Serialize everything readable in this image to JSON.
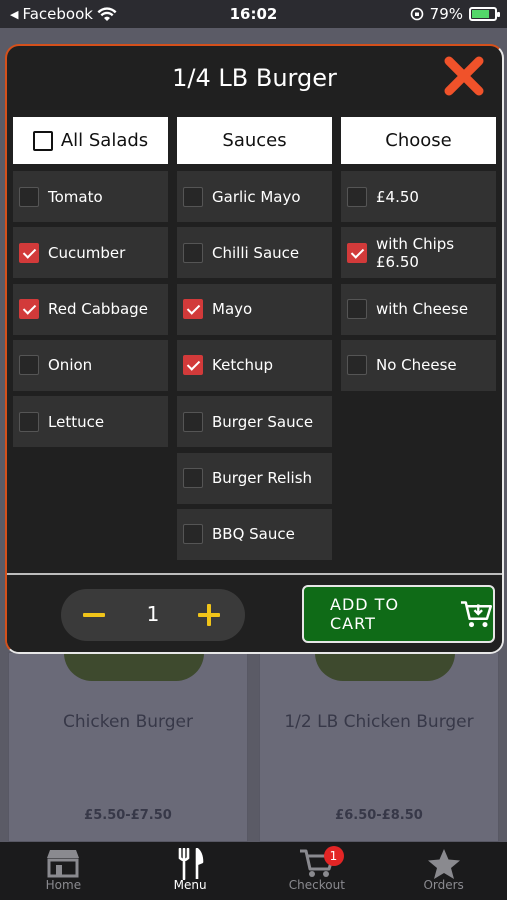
{
  "status_bar": {
    "back_app": "Facebook",
    "time": "16:02",
    "battery_percent": "79%",
    "battery_level": 0.79
  },
  "modal": {
    "title": "1/4 LB Burger",
    "columns": [
      {
        "header": "All Salads",
        "has_header_checkbox": true,
        "items": [
          {
            "label": "Tomato",
            "checked": false
          },
          {
            "label": "Cucumber",
            "checked": true
          },
          {
            "label": "Red Cabbage",
            "checked": true
          },
          {
            "label": "Onion",
            "checked": false
          },
          {
            "label": "Lettuce",
            "checked": false
          }
        ]
      },
      {
        "header": "Sauces",
        "has_header_checkbox": false,
        "items": [
          {
            "label": "Garlic Mayo",
            "checked": false
          },
          {
            "label": "Chilli Sauce",
            "checked": false
          },
          {
            "label": "Mayo",
            "checked": true
          },
          {
            "label": "Ketchup",
            "checked": true
          },
          {
            "label": "Burger Sauce",
            "checked": false
          },
          {
            "label": "Burger Relish",
            "checked": false
          },
          {
            "label": "BBQ Sauce",
            "checked": false
          }
        ]
      },
      {
        "header": "Choose",
        "has_header_checkbox": false,
        "items": [
          {
            "label": "£4.50",
            "checked": false
          },
          {
            "label": "with Chips £6.50",
            "checked": true
          },
          {
            "label": "with Cheese",
            "checked": false
          },
          {
            "label": "No Cheese",
            "checked": false
          }
        ]
      }
    ],
    "quantity": "1",
    "add_to_cart_label": "ADD TO CART"
  },
  "background_products": [
    {
      "name": "Chicken Burger",
      "price": "£5.50-£7.50"
    },
    {
      "name": "1/2 LB Chicken Burger",
      "price": "£6.50-£8.50"
    }
  ],
  "tabbar": {
    "tabs": [
      {
        "label": "Home",
        "icon": "store-icon",
        "active": false
      },
      {
        "label": "Menu",
        "icon": "fork-knife-icon",
        "active": true
      },
      {
        "label": "Checkout",
        "icon": "cart-icon",
        "active": false,
        "badge": "1"
      },
      {
        "label": "Orders",
        "icon": "star-icon",
        "active": false
      }
    ]
  },
  "colors": {
    "checked": "#d23a3a",
    "add_to_cart_bg": "#0f6b17",
    "close_x": "#f0522a",
    "quantity_controls": "#f0c419",
    "modal_border": "#d5501b"
  }
}
